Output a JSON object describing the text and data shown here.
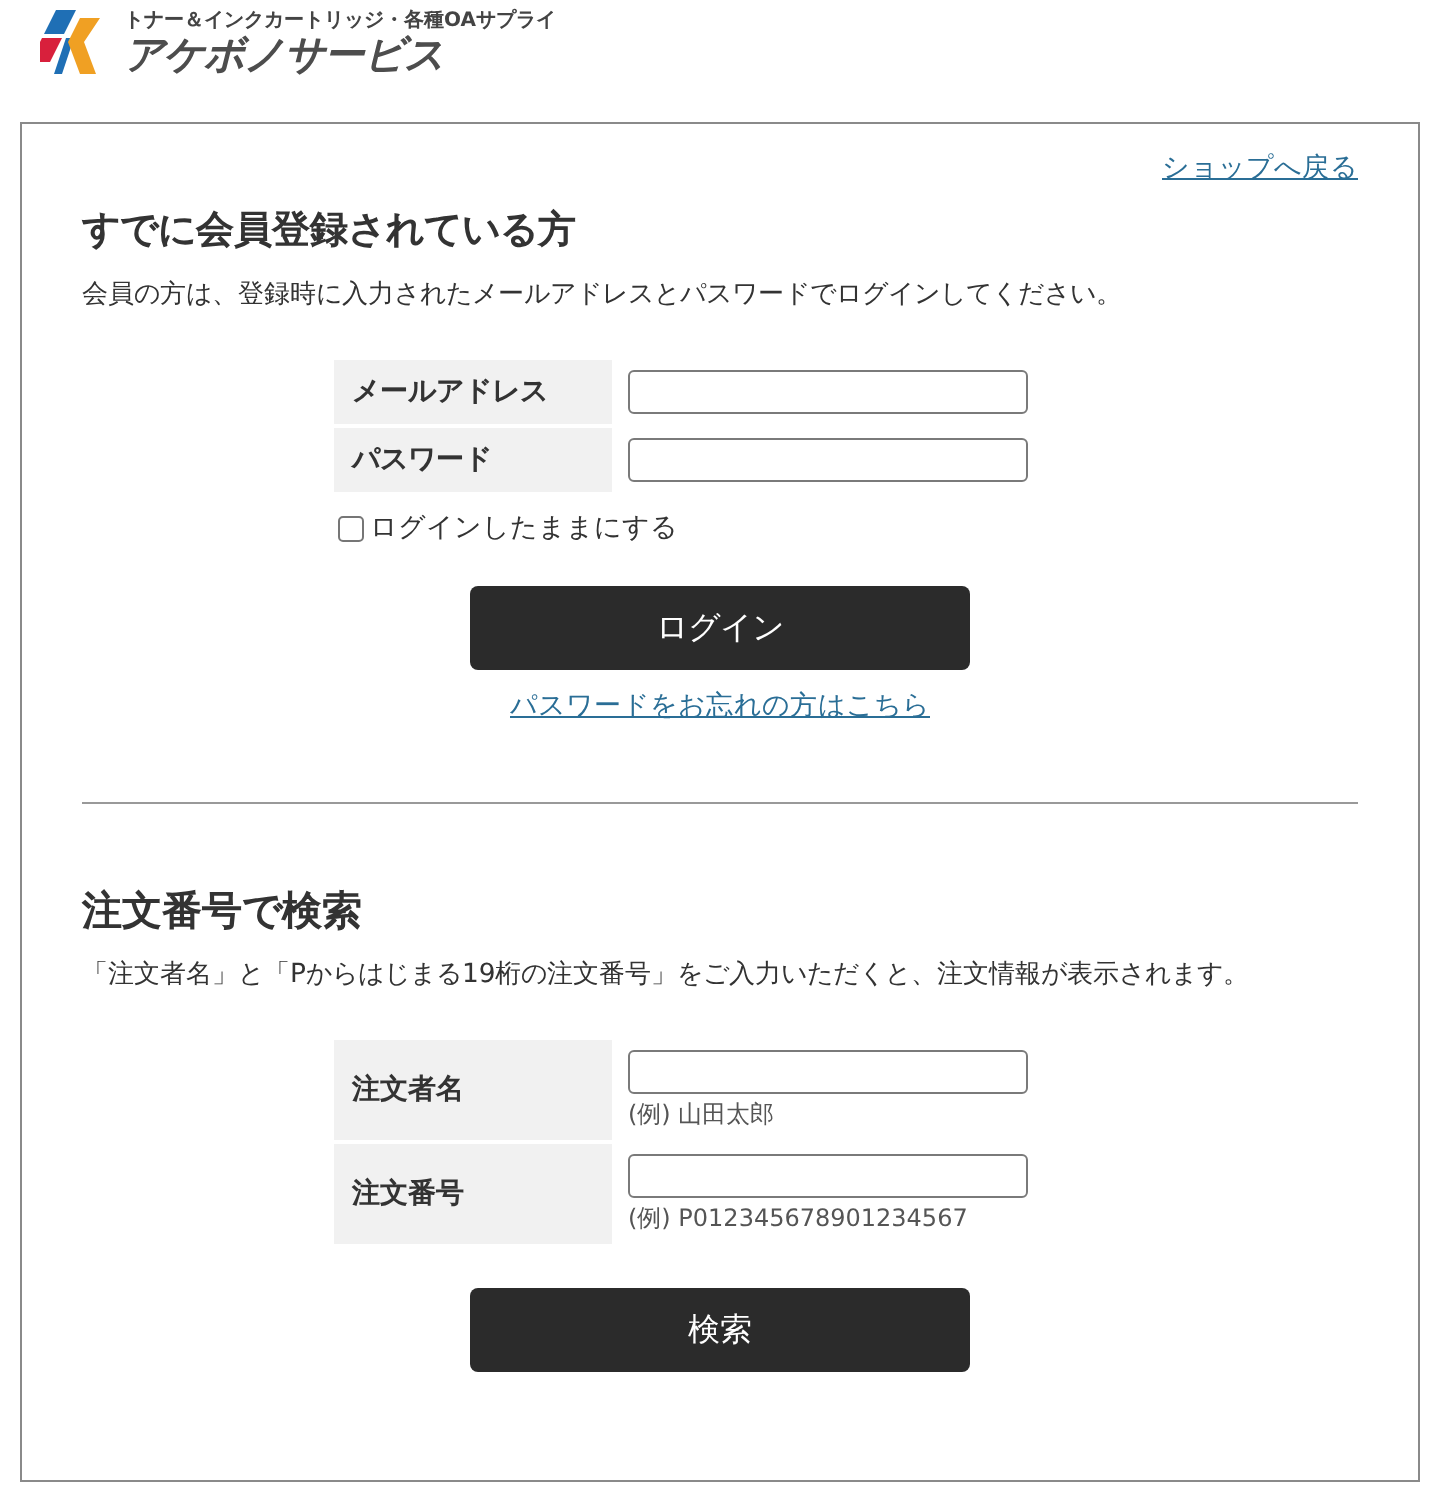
{
  "header": {
    "tagline": "トナー＆インクカートリッジ・各種OAサプライ",
    "brand": "アケボノサービス"
  },
  "back_link": "ショップへ戻る",
  "login": {
    "title": "すでに会員登録されている方",
    "description": "会員の方は、登録時に入力されたメールアドレスとパスワードでログインしてください。",
    "fields": [
      {
        "label": "メールアドレス"
      },
      {
        "label": "パスワード"
      }
    ],
    "remember": {
      "label": "ログインしたままにする",
      "checked": false
    },
    "button": "ログイン",
    "forgot_link": "パスワードをお忘れの方はこちら"
  },
  "order_search": {
    "title": "注文番号で検索",
    "description": "「注文者名」と「Pからはじまる19桁の注文番号」をご入力いただくと、注文情報が表示されます。",
    "fields": [
      {
        "label": "注文者名",
        "hint": "(例) 山田太郎"
      },
      {
        "label": "注文番号",
        "hint": "(例) P012345678901234567"
      }
    ],
    "button": "検索"
  }
}
